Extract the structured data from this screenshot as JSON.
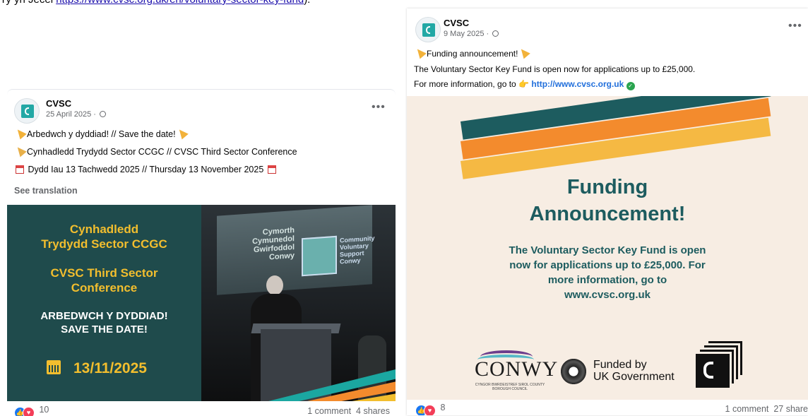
{
  "top_fragment": {
    "prefix": "Ty yn Jecel",
    "link_text": "https://www.cvsc.org.uk/en/voluntary-sector-key-fund",
    "suffix": ")."
  },
  "post1": {
    "page_name": "CVSC",
    "date": "25 April 2025 ·",
    "more": "•••",
    "lines": [
      "Arbedwch y dyddiad! // Save the date!",
      "Cynhadledd Trydydd Sector CCGC // CVSC Third Sector Conference",
      "Dydd Iau 13 Tachwedd 2025 // Thursday 13 November 2025"
    ],
    "see_translation": "See translation",
    "image": {
      "title_cy_1": "Cynhadledd",
      "title_cy_2": "Trydydd Sector CCGC",
      "title_en_1": "CVSC Third Sector",
      "title_en_2": "Conference",
      "save_cy": "ARBEDWCH Y DYDDIAD!",
      "save_en": "SAVE THE DATE!",
      "date": "13/11/2025",
      "screen_text": "Cymorth\nCymunedol\nGwirfoddol\nConwy",
      "screen_text_en": "Community\nVoluntary\nSupport\nConwy"
    },
    "reactions_count": "10",
    "comments": "1 comment",
    "shares": "4 shares"
  },
  "post2": {
    "page_name": "CVSC",
    "date": "9 May 2025 ·",
    "more": "•••",
    "line1": "Funding announcement!",
    "line2": "The Voluntary Sector Key Fund is open now for applications up to £25,000.",
    "line3_prefix": "For more information, go to",
    "line3_link": "http://www.cvsc.org.uk",
    "image": {
      "title_1": "Funding",
      "title_2": "Announcement!",
      "para_1": "The Voluntary Sector Key Fund is open",
      "para_2": "now for applications up to £25,000. For",
      "para_3": "more information, go to",
      "para_4": "www.cvsc.org.uk",
      "conwy": "CONWY",
      "conwy_sub": "CYNGOR BWRDEISTREF SIROL COUNTY BOROUGH COUNCIL",
      "funded_1": "Funded by",
      "funded_2": "UK Government"
    },
    "reactions_count": "8",
    "comments": "1 comment",
    "shares": "27 share"
  },
  "colors": {
    "teal_dark": "#1f4b4c",
    "gold": "#f2be2e",
    "funding_teal": "#1d5c5f",
    "cream": "#f7ede3",
    "like_blue": "#1877f2",
    "love_red": "#f33e58"
  }
}
